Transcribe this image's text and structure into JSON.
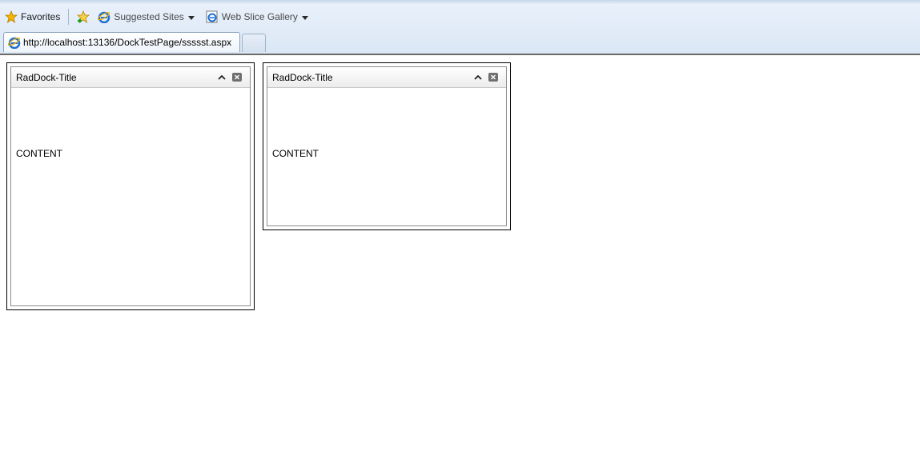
{
  "browser": {
    "favorites_label": "Favorites",
    "suggested_sites_label": "Suggested Sites",
    "web_slice_gallery_label": "Web Slice Gallery",
    "active_tab_url": "http://localhost:13136/DockTestPage/ssssst.aspx"
  },
  "docks": [
    {
      "title": "RadDock-Title",
      "content": "CONTENT"
    },
    {
      "title": "RadDock-Title",
      "content": "CONTENT"
    }
  ],
  "colors": {
    "chrome_background": "#dbe7f5",
    "favorites_star": "#f5b400",
    "ie_icon_blue": "#1e6fd1"
  },
  "icons": {
    "favorites": "star-icon",
    "add_favorites": "add-to-favorites-icon",
    "suggested_sites": "internet-explorer-icon",
    "web_slice": "web-slice-icon",
    "tab": "internet-explorer-icon",
    "collapse": "chevron-up-icon",
    "close": "close-icon"
  }
}
